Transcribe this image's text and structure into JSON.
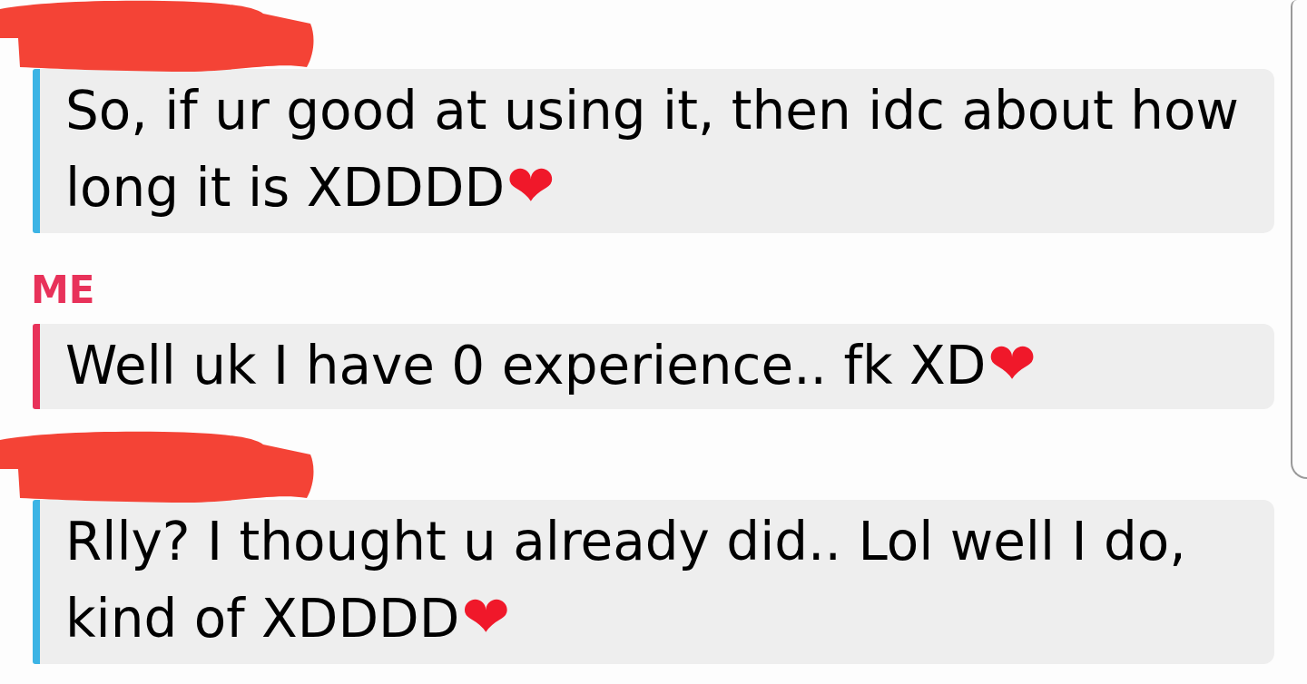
{
  "messages": [
    {
      "kind": "received",
      "sender_redacted": true,
      "text": "So, if ur good at using it, then idc about how long it is XDDDD",
      "emoji": "❤"
    },
    {
      "kind": "sent",
      "sender": "ME",
      "text": "Well uk I have 0 experience.. fk XD",
      "emoji": "❤"
    },
    {
      "kind": "received",
      "sender_redacted": true,
      "text": "Rlly? I thought u already did.. Lol well I do, kind of XDDDD",
      "emoji": "❤"
    }
  ]
}
